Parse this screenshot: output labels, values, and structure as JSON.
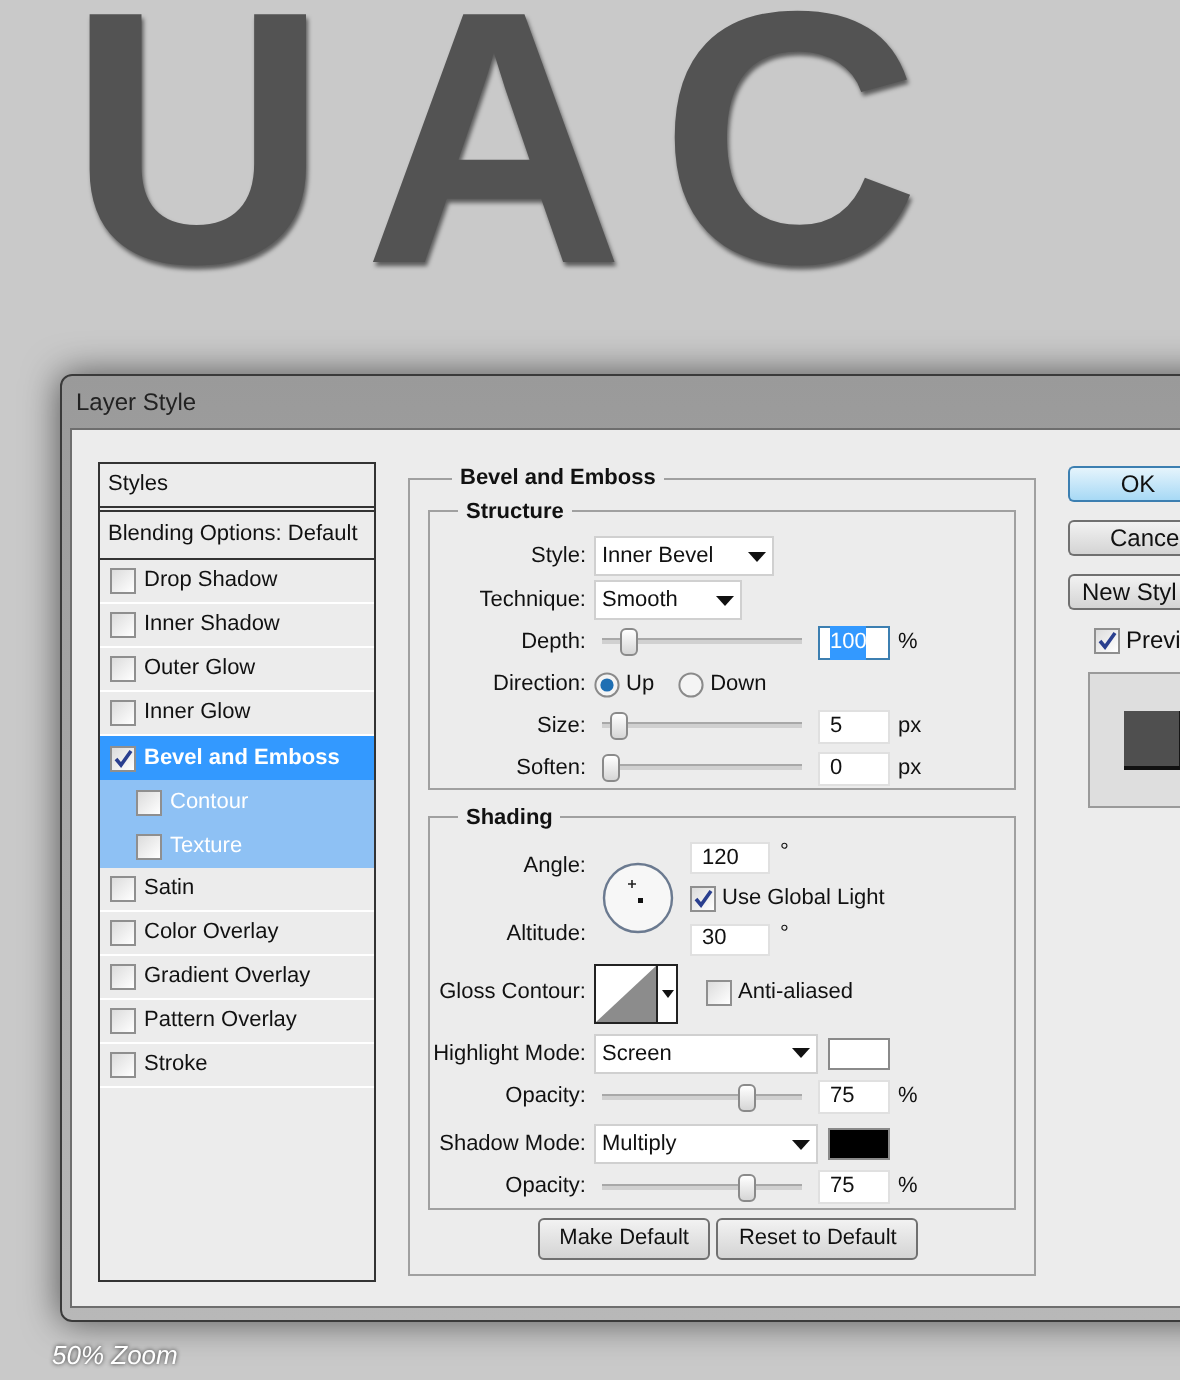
{
  "canvas_text": "UAC",
  "dialog": {
    "title": "Layer Style"
  },
  "styles_panel": {
    "header": "Styles",
    "blending_options": "Blending Options: Default",
    "items": [
      {
        "label": "Drop Shadow",
        "checked": false,
        "selected": false
      },
      {
        "label": "Inner Shadow",
        "checked": false,
        "selected": false
      },
      {
        "label": "Outer Glow",
        "checked": false,
        "selected": false
      },
      {
        "label": "Inner Glow",
        "checked": false,
        "selected": false
      },
      {
        "label": "Bevel and Emboss",
        "checked": true,
        "selected": true,
        "children": [
          {
            "label": "Contour",
            "checked": false,
            "selected": false
          },
          {
            "label": "Texture",
            "checked": false,
            "selected": false
          }
        ]
      },
      {
        "label": "Satin",
        "checked": false,
        "selected": false
      },
      {
        "label": "Color Overlay",
        "checked": false,
        "selected": false
      },
      {
        "label": "Gradient Overlay",
        "checked": false,
        "selected": false
      },
      {
        "label": "Pattern Overlay",
        "checked": false,
        "selected": false
      },
      {
        "label": "Stroke",
        "checked": false,
        "selected": false
      }
    ]
  },
  "bevel_and_emboss": {
    "title": "Bevel and Emboss",
    "structure": {
      "title": "Structure",
      "rows": [
        {
          "kind": "select",
          "label": "Style:",
          "value": "Inner Bevel"
        },
        {
          "kind": "select",
          "label": "Technique:",
          "value": "Smooth"
        },
        {
          "kind": "slider",
          "label": "Depth:",
          "level": 0.1,
          "value": "100",
          "unit": "%",
          "focused": true
        },
        {
          "kind": "radio",
          "label": "Direction:",
          "options": [
            {
              "label": "Up",
              "selected": true
            },
            {
              "label": "Down",
              "selected": false
            }
          ]
        },
        {
          "kind": "slider",
          "label": "Size:",
          "level": 0.04,
          "value": "5",
          "unit": "px",
          "focused": false
        },
        {
          "kind": "slider",
          "label": "Soften:",
          "level": 0,
          "value": "0",
          "unit": "px",
          "focused": false
        }
      ]
    },
    "shading": {
      "title": "Shading",
      "angle": {
        "label": "Angle:",
        "value": "120",
        "unit": "°"
      },
      "use_global_light": {
        "label": "Use Global Light",
        "checked": true
      },
      "altitude": {
        "label": "Altitude:",
        "value": "30",
        "unit": "°"
      },
      "gloss_contour": {
        "label": "Gloss Contour:"
      },
      "anti_aliased": {
        "label": "Anti-aliased",
        "checked": false
      },
      "rows": [
        {
          "kind": "mode",
          "label": "Highlight Mode:",
          "value": "Screen",
          "color": "#ffffff"
        },
        {
          "kind": "slider",
          "label": "Opacity:",
          "level": 0.75,
          "value": "75",
          "unit": "%",
          "focused": false
        },
        {
          "kind": "mode",
          "label": "Shadow Mode:",
          "value": "Multiply",
          "color": "#000000"
        },
        {
          "kind": "slider",
          "label": "Opacity:",
          "level": 0.75,
          "value": "75",
          "unit": "%",
          "focused": false
        }
      ]
    },
    "buttons": [
      "Make Default",
      "Reset to Default"
    ]
  },
  "side_buttons": [
    {
      "label": "OK",
      "default": true
    },
    {
      "label": "Cance",
      "default": false
    },
    {
      "label": "New Styl",
      "default": false
    }
  ],
  "preview": {
    "label": "Previ",
    "checked": true
  },
  "caption": "50% Zoom"
}
